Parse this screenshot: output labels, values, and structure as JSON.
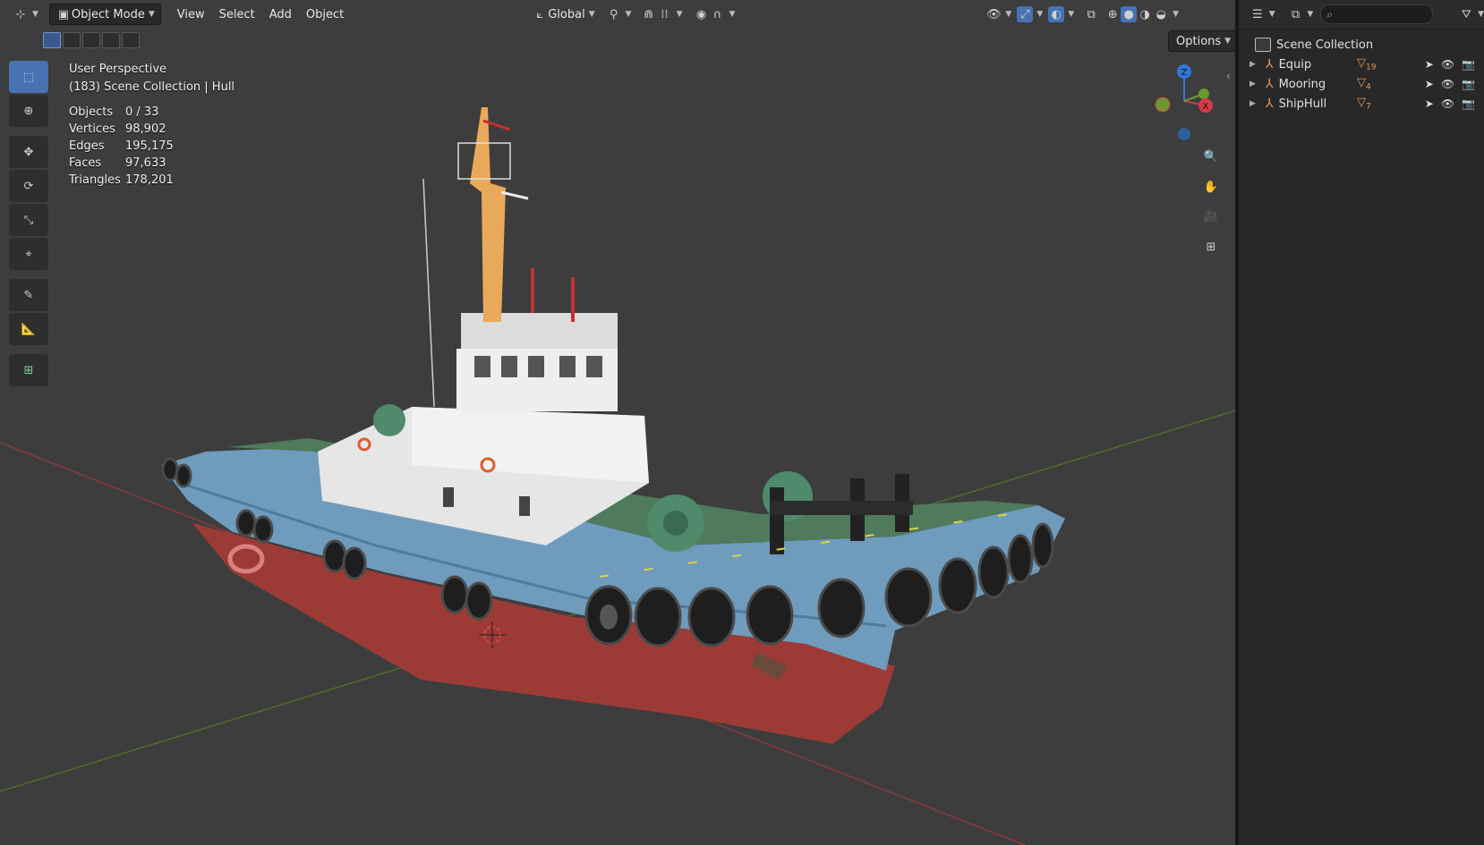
{
  "header": {
    "editor_type_icon": "editor-type-icon",
    "mode_label": "Object Mode",
    "menus": [
      "View",
      "Select",
      "Add",
      "Object"
    ],
    "transform_orientation": "Global",
    "options_label": "Options"
  },
  "overlay": {
    "view_name": "User Perspective",
    "collection_line": "(183) Scene Collection | Hull",
    "stats": [
      {
        "label": "Objects",
        "value": "0 / 33"
      },
      {
        "label": "Vertices",
        "value": "98,902"
      },
      {
        "label": "Edges",
        "value": "195,175"
      },
      {
        "label": "Faces",
        "value": "97,633"
      },
      {
        "label": "Triangles",
        "value": "178,201"
      }
    ]
  },
  "gizmo": {
    "z": "Z",
    "x": "X"
  },
  "outliner": {
    "root": "Scene Collection",
    "items": [
      {
        "name": "Equip",
        "count": "19"
      },
      {
        "name": "Mooring",
        "count": "4"
      },
      {
        "name": "ShipHull",
        "count": "7"
      }
    ]
  },
  "colors": {
    "accent": "#4772b3",
    "axis_x": "#c4404c",
    "axis_y": "#6a9a2e",
    "axis_z": "#2f7ad9",
    "object_orange": "#e3995a"
  }
}
